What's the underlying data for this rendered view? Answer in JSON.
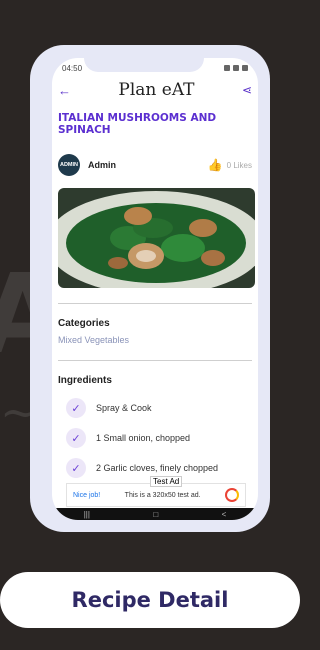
{
  "status": {
    "time": "04:50"
  },
  "app": {
    "logo": "Plan eAT"
  },
  "recipe": {
    "title": "ITALIAN MUSHROOMS AND SPINACH",
    "author": "Admin",
    "avatar_text": "ADMIN",
    "likes": "0 Likes"
  },
  "sections": {
    "categories": "Categories",
    "ingredients": "Ingredients"
  },
  "category_value": "Mixed Vegetables",
  "ingredients": [
    "Spray & Cook",
    "1  Small onion, chopped",
    "2  Garlic cloves, finely chopped"
  ],
  "ad": {
    "tag": "Test Ad",
    "nice": "Nice job!",
    "text": "This is a 320x50 test ad."
  },
  "caption": "Recipe Detail",
  "colors": {
    "accent": "#5b2fd0",
    "caption": "#2f2965"
  }
}
